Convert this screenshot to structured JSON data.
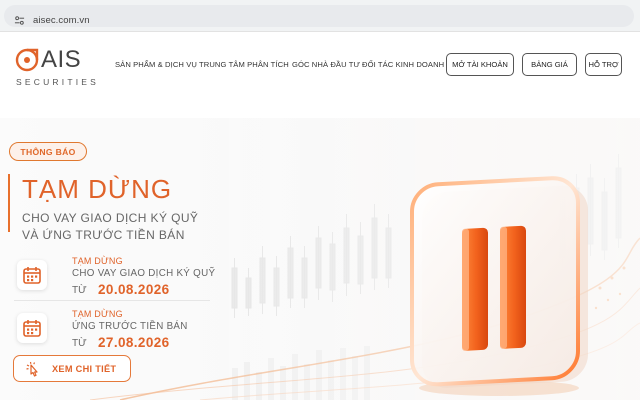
{
  "browser": {
    "url": "aisec.com.vn",
    "site_info_icon": "site-settings-icon"
  },
  "header": {
    "logo": {
      "main": "AIS",
      "sub": "SECURITIES"
    },
    "menu": [
      {
        "label": "SẢN PHẨM & DỊCH VỤ"
      },
      {
        "label": "TRUNG TÂM PHÂN TÍCH"
      },
      {
        "label": "GÓC NHÀ ĐẦU TƯ"
      },
      {
        "label": "ĐỐI TÁC KINH DOANH"
      }
    ],
    "buttons": {
      "open_account": "MỞ TÀI KHOẢN",
      "price_board": "BẢNG GIÁ",
      "support": "HỖ TRỢ"
    }
  },
  "hero": {
    "badge": "THÔNG BÁO",
    "title": "TẠM DỪNG",
    "subtitle_line1": "CHO VAY GIAO DỊCH KÝ QUỸ",
    "subtitle_line2": "VÀ ỨNG TRƯỚC TIỀN BÁN",
    "items": [
      {
        "status": "TẠM DỪNG",
        "service": "CHO VAY GIAO DỊCH KÝ QUỸ",
        "from_label": "TỪ",
        "date": "20.08.2026",
        "icon": "calendar-icon"
      },
      {
        "status": "TẠM DỪNG",
        "service": "ỨNG TRƯỚC TIỀN BÁN",
        "from_label": "TỪ",
        "date": "27.08.2026",
        "icon": "calendar-icon"
      }
    ],
    "cta": {
      "label": "XEM CHI TIẾT",
      "icon": "pointer-click-icon"
    },
    "illustration": "pause-icon"
  },
  "colors": {
    "accent": "#e0632a",
    "accent_light": "#fdf1ea",
    "text": "#333333",
    "muted": "#666666"
  }
}
